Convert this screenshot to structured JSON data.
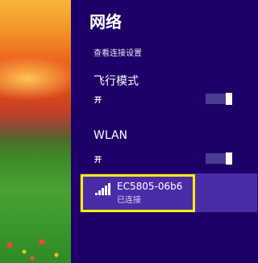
{
  "panel": {
    "title": "网络",
    "settings_link": "查看连接设置"
  },
  "airplane_mode": {
    "label": "飞行模式",
    "state": "开"
  },
  "wlan": {
    "label": "WLAN",
    "state": "开"
  },
  "network": {
    "name": "EC5805-06b6",
    "status": "已连接",
    "signal_bars": 5
  },
  "colors": {
    "panel_background": "#1f0068",
    "selected_item": "#4a2ca8",
    "highlight_border": "#f7ee0b",
    "toggle_track": "#4a3b93"
  }
}
